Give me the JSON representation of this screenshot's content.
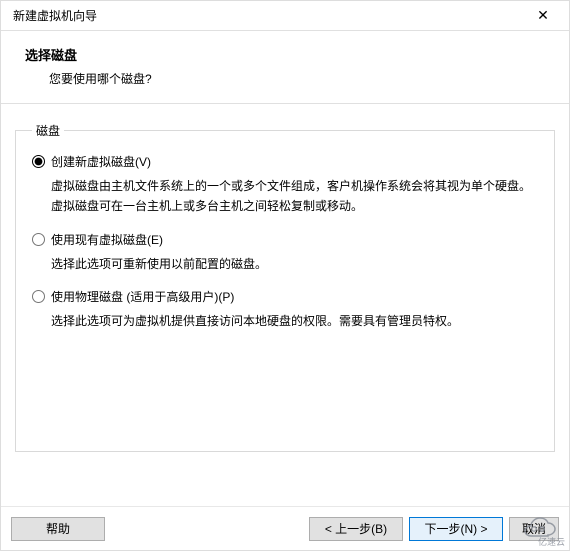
{
  "window": {
    "title": "新建虚拟机向导",
    "close_glyph": "✕"
  },
  "header": {
    "heading": "选择磁盘",
    "sub": "您要使用哪个磁盘?"
  },
  "group": {
    "legend": "磁盘"
  },
  "options": [
    {
      "label": "创建新虚拟磁盘(V)",
      "desc": "虚拟磁盘由主机文件系统上的一个或多个文件组成，客户机操作系统会将其视为单个硬盘。虚拟磁盘可在一台主机上或多台主机之间轻松复制或移动。",
      "checked": true
    },
    {
      "label": "使用现有虚拟磁盘(E)",
      "desc": "选择此选项可重新使用以前配置的磁盘。",
      "checked": false
    },
    {
      "label": "使用物理磁盘 (适用于高级用户)(P)",
      "desc": "选择此选项可为虚拟机提供直接访问本地硬盘的权限。需要具有管理员特权。",
      "checked": false
    }
  ],
  "footer": {
    "help": "帮助",
    "back": "< 上一步(B)",
    "next": "下一步(N) >",
    "cancel": "取消"
  },
  "watermark": {
    "text": "亿速云"
  }
}
